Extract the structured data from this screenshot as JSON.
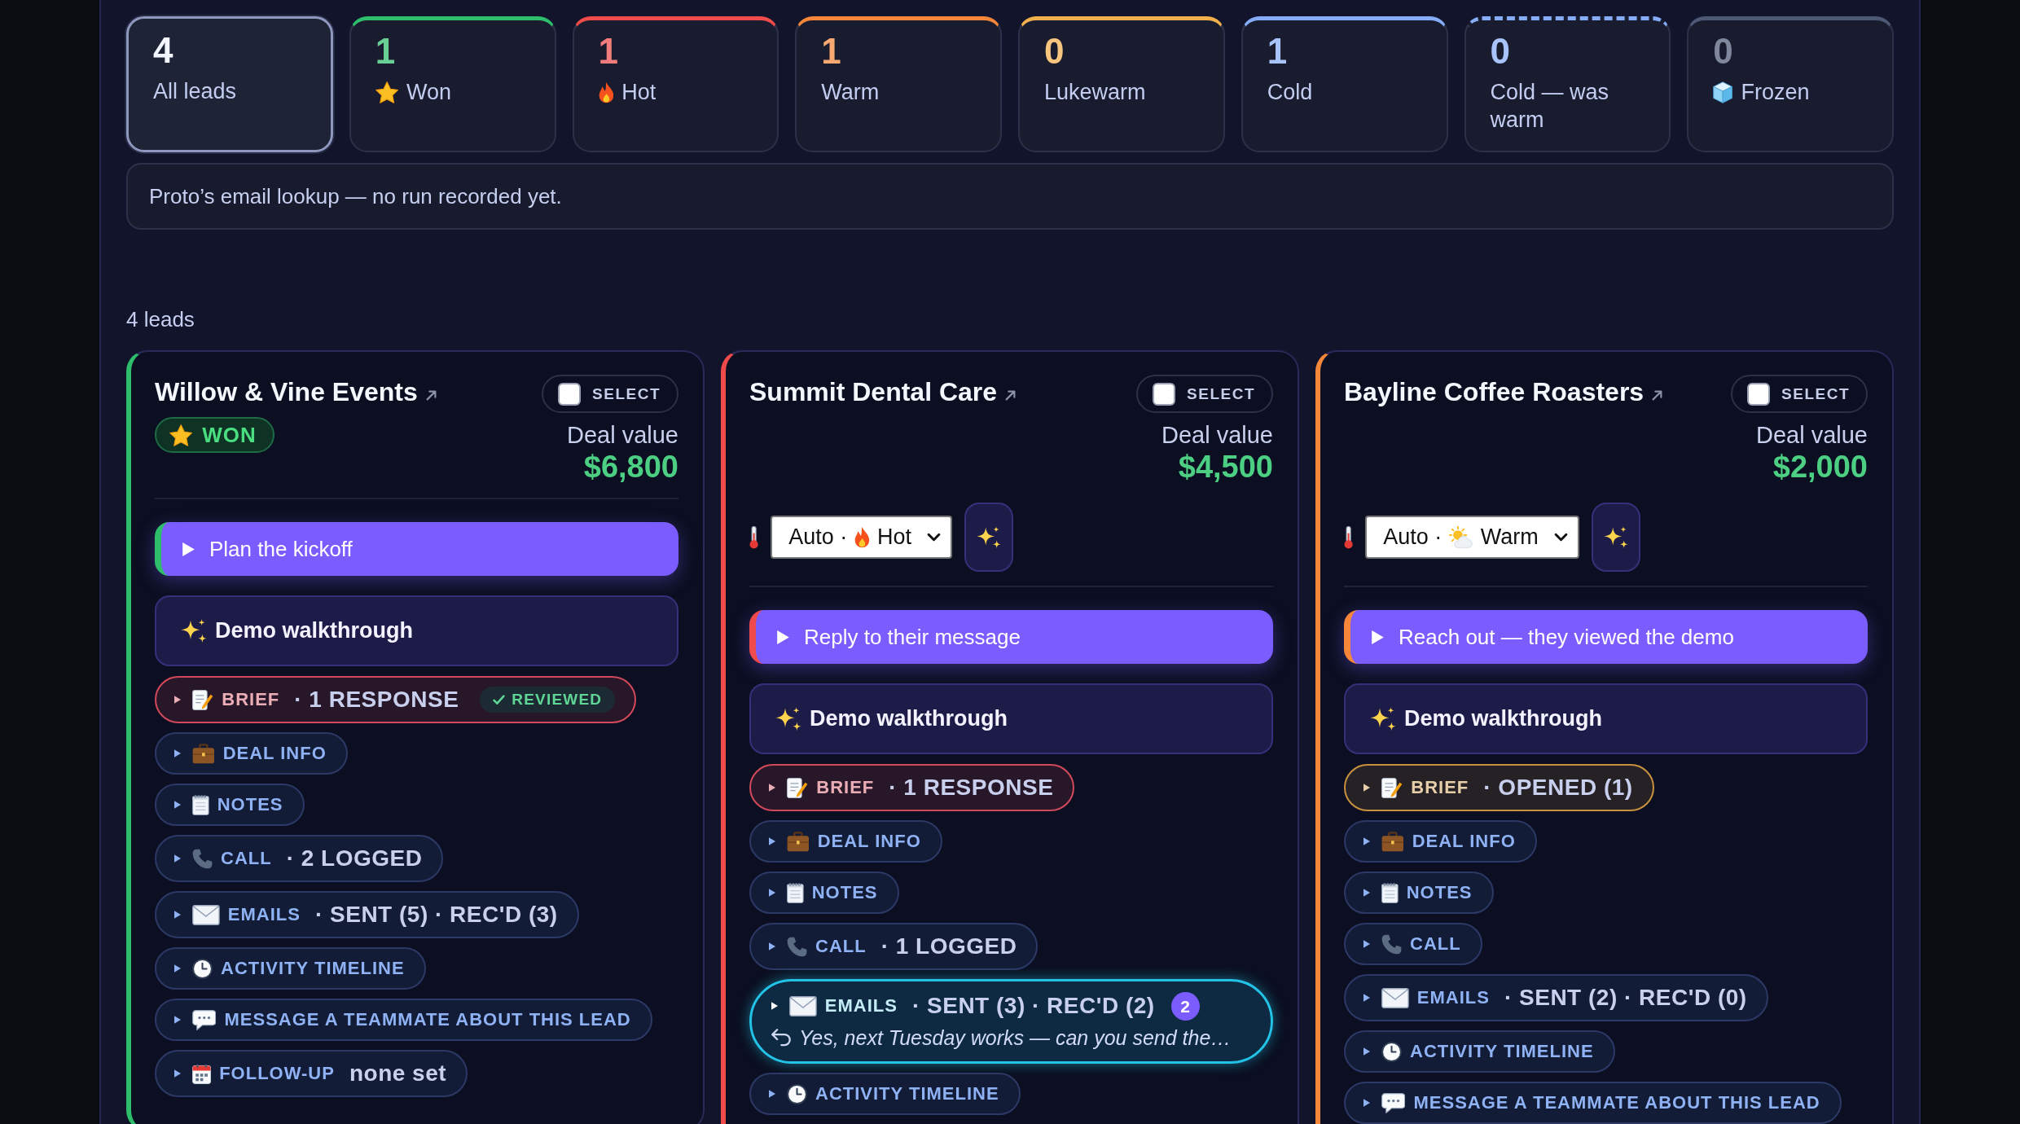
{
  "stats": [
    {
      "kind": "all",
      "count": "4",
      "label": "All leads",
      "selected": true,
      "dashed": false
    },
    {
      "kind": "won",
      "count": "1",
      "label": "Won",
      "color": "#2ebd6b",
      "selected": false,
      "dashed": false
    },
    {
      "kind": "hot",
      "count": "1",
      "label": "Hot",
      "color": "#ef4b4b",
      "selected": false,
      "dashed": false
    },
    {
      "kind": "warm",
      "count": "1",
      "label": "Warm",
      "color": "#f5863a",
      "selected": false,
      "dashed": false
    },
    {
      "kind": "lukewarm",
      "count": "0",
      "label": "Lukewarm",
      "color": "#f2b04c",
      "selected": false,
      "dashed": false
    },
    {
      "kind": "cold",
      "count": "1",
      "label": "Cold",
      "color": "#86acf7",
      "selected": false,
      "dashed": false
    },
    {
      "kind": "cold-was-warm",
      "count": "0",
      "label": "Cold — was warm",
      "color": "#86acf7",
      "selected": false,
      "dashed": true
    },
    {
      "kind": "frozen",
      "count": "0",
      "label": "Frozen",
      "color": "#4d5875",
      "selected": false,
      "dashed": false
    }
  ],
  "notice": "Proto’s email lookup — no run recorded yet.",
  "lead_count": "4 leads",
  "leads": [
    {
      "name": "Willow & Vine Events",
      "color": "#2ebd6b",
      "checked": false,
      "select_label": "SELECT",
      "badge": {
        "kind": "won",
        "label": "WON"
      },
      "deal_label": "Deal value",
      "deal_value": "$6,800",
      "next_action": "Plan the kickoff",
      "demo": "Demo walkthrough",
      "sections": [
        {
          "kind": "brief",
          "label": "BRIEF",
          "summary": "· 1 RESPONSE",
          "badge": "REVIEWED",
          "color": "#d1495b",
          "expanded": false,
          "highlighted": false
        },
        {
          "kind": "deal",
          "label": "DEAL INFO",
          "expanded": false,
          "highlighted": false
        },
        {
          "kind": "notes",
          "label": "NOTES",
          "expanded": false,
          "highlighted": false
        },
        {
          "kind": "call",
          "label": "CALL",
          "summary": "· 2 LOGGED",
          "expanded": false,
          "highlighted": false
        },
        {
          "kind": "emails",
          "label": "EMAILS",
          "summary": "· SENT (5) · REC'D (3)",
          "expanded": false,
          "highlighted": false
        },
        {
          "kind": "activity",
          "label": "ACTIVITY TIMELINE",
          "expanded": false,
          "highlighted": false
        },
        {
          "kind": "message",
          "label": "MESSAGE A TEAMMATE ABOUT THIS LEAD",
          "expanded": false,
          "highlighted": false
        },
        {
          "kind": "followup",
          "label": "FOLLOW-UP",
          "summary": "none set",
          "expanded": false,
          "highlighted": false
        }
      ]
    },
    {
      "name": "Summit Dental Care",
      "color": "#ef4b4b",
      "checked": false,
      "select_label": "SELECT",
      "deal_label": "Deal value",
      "deal_value": "$4,500",
      "temperature": {
        "kind": "hot",
        "mode": "Auto ·",
        "label": "Hot"
      },
      "next_action": "Reply to their message",
      "demo": "Demo walkthrough",
      "sections": [
        {
          "kind": "brief",
          "label": "BRIEF",
          "summary": "· 1 RESPONSE",
          "color": "#d1495b",
          "expanded": false,
          "highlighted": false
        },
        {
          "kind": "deal",
          "label": "DEAL INFO",
          "expanded": false,
          "highlighted": false
        },
        {
          "kind": "notes",
          "label": "NOTES",
          "expanded": false,
          "highlighted": false
        },
        {
          "kind": "call",
          "label": "CALL",
          "summary": "· 1 LOGGED",
          "expanded": false,
          "highlighted": false
        },
        {
          "kind": "emails",
          "label": "EMAILS",
          "summary": "· SENT (3) · REC'D (2)",
          "unread": "2",
          "preview": "Yes, next Tuesday works — can you send the…",
          "expanded": false,
          "highlighted": true
        },
        {
          "kind": "activity",
          "label": "ACTIVITY TIMELINE",
          "expanded": false,
          "highlighted": false
        }
      ]
    },
    {
      "name": "Bayline Coffee Roasters",
      "color": "#f5863a",
      "checked": false,
      "select_label": "SELECT",
      "deal_label": "Deal value",
      "deal_value": "$2,000",
      "temperature": {
        "kind": "warm",
        "mode": "Auto ·",
        "label": "Warm"
      },
      "next_action": "Reach out — they viewed the demo",
      "demo": "Demo walkthrough",
      "sections": [
        {
          "kind": "brief",
          "label": "BRIEF",
          "summary": "· OPENED (1)",
          "color": "#c8913f",
          "expanded": false,
          "highlighted": false
        },
        {
          "kind": "deal",
          "label": "DEAL INFO",
          "expanded": false,
          "highlighted": false
        },
        {
          "kind": "notes",
          "label": "NOTES",
          "expanded": false,
          "highlighted": false
        },
        {
          "kind": "call",
          "label": "CALL",
          "expanded": false,
          "highlighted": false
        },
        {
          "kind": "emails",
          "label": "EMAILS",
          "summary": "· SENT (2) · REC'D (0)",
          "expanded": false,
          "highlighted": false
        },
        {
          "kind": "activity",
          "label": "ACTIVITY TIMELINE",
          "expanded": false,
          "highlighted": false
        },
        {
          "kind": "message",
          "label": "MESSAGE A TEAMMATE ABOUT THIS LEAD",
          "expanded": false,
          "highlighted": false
        }
      ]
    }
  ]
}
